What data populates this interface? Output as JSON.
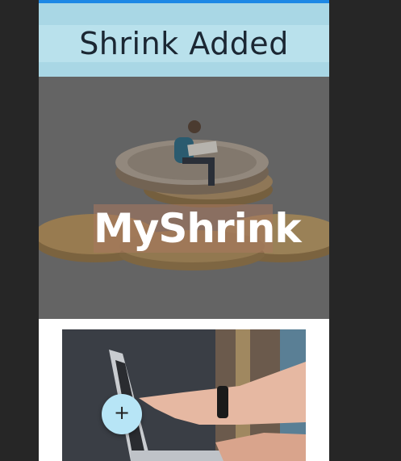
{
  "header": {
    "title": "Shrink Added"
  },
  "hero": {
    "brand": "MyShrink",
    "image_icon": "coins-with-reading-figure-photo"
  },
  "card": {
    "image_icon": "laptop-pointing-photo"
  },
  "fab": {
    "label": "+",
    "icon": "plus-icon"
  },
  "colors": {
    "accent_bar": "#1e88e5",
    "header_background": "#a9d7e5",
    "fab_background": "#b7e5f6",
    "page_background": "#262626"
  }
}
